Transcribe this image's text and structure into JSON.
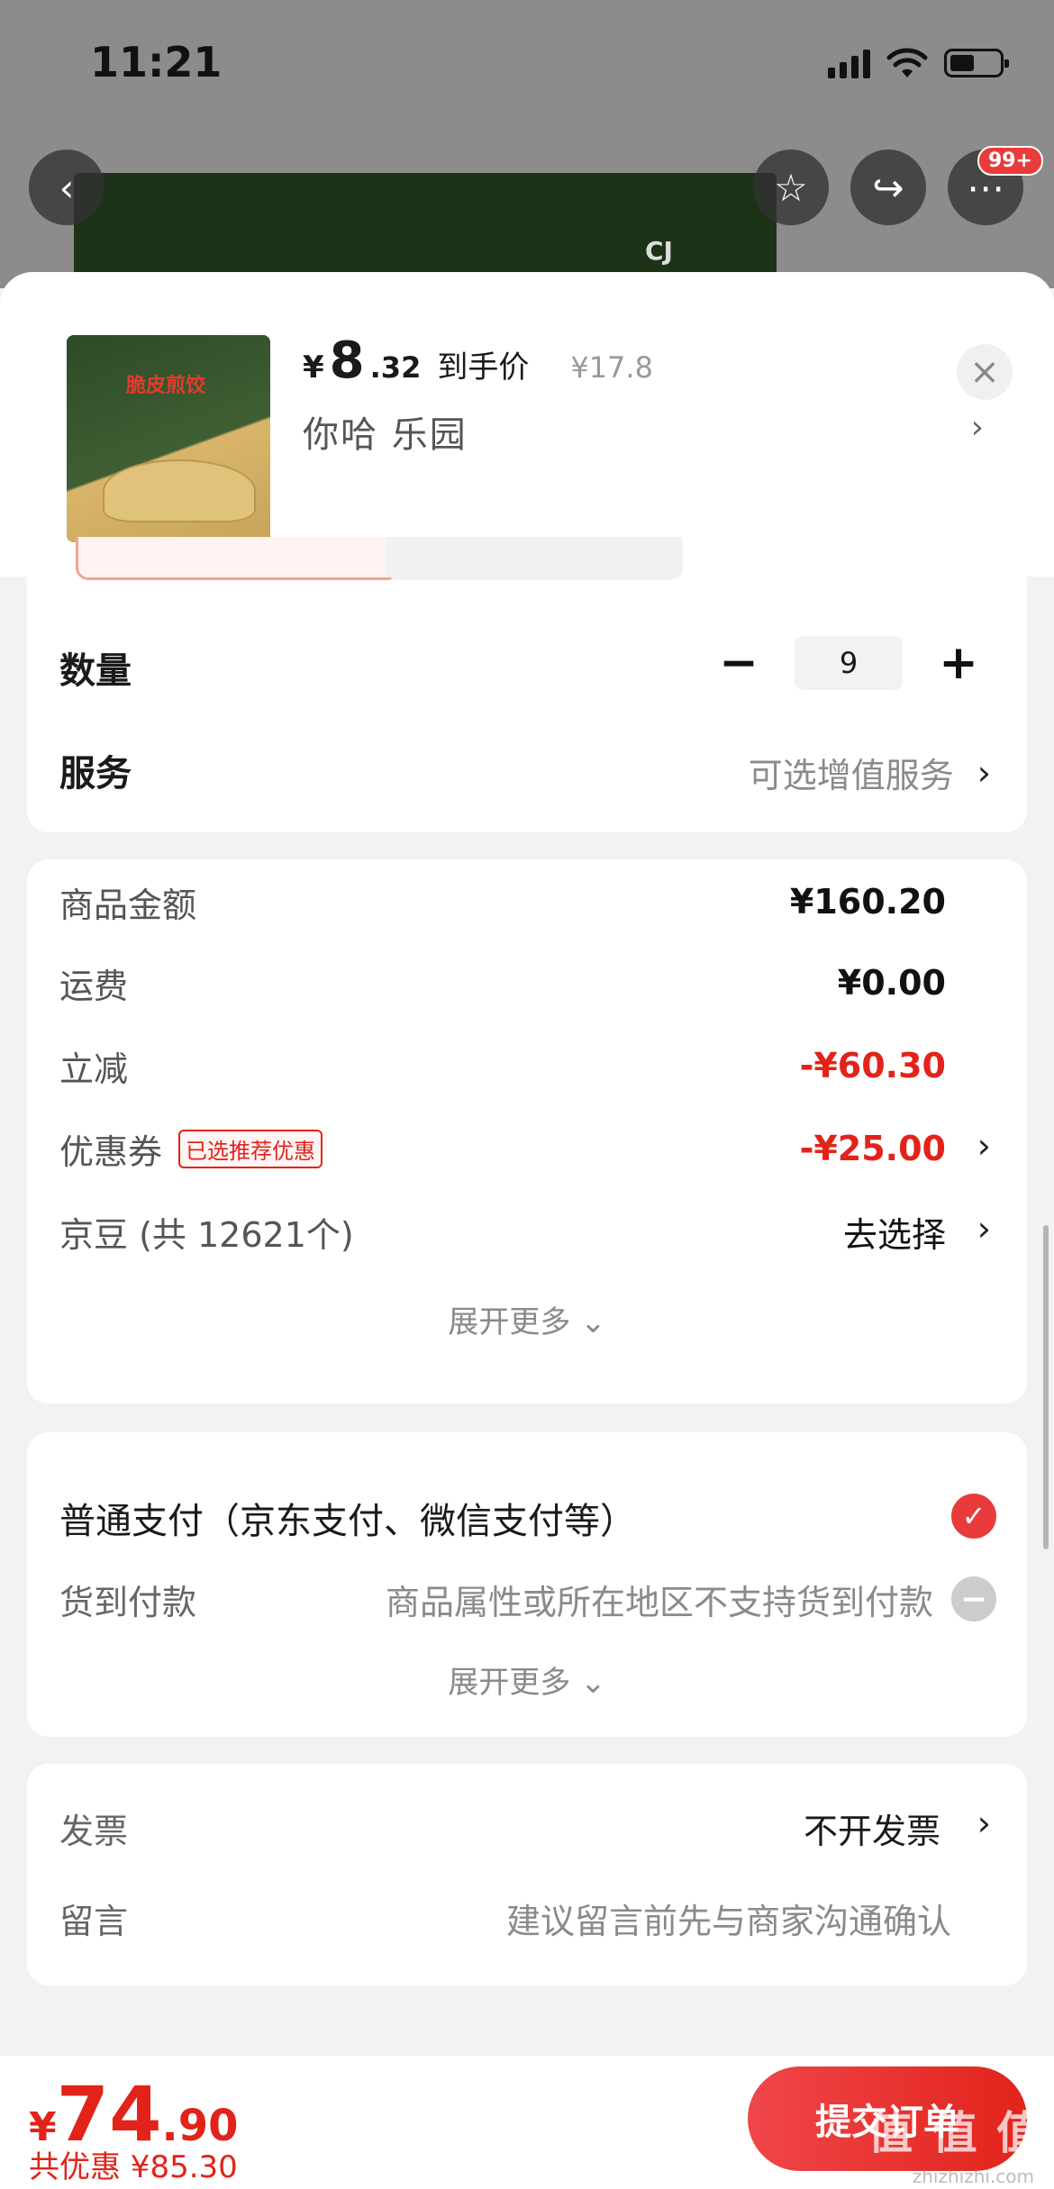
{
  "status": {
    "time": "11:21"
  },
  "header": {
    "badge": "99+"
  },
  "product": {
    "price_symbol": "¥",
    "price_int": "8",
    "price_dec": ".32",
    "price_tag": "到手价",
    "orig_price": "¥17.8",
    "spec": "你哈  乐园",
    "thumb_title": "脆皮煎饺"
  },
  "quantity": {
    "label": "数量",
    "value": "9"
  },
  "service": {
    "label": "服务",
    "value": "可选增值服务"
  },
  "amounts": {
    "goods_label": "商品金额",
    "goods_value": "¥160.20",
    "shipping_label": "运费",
    "shipping_value": "¥0.00",
    "discount_label": "立减",
    "discount_value": "-¥60.30",
    "coupon_label": "优惠券",
    "coupon_tag": "已选推荐优惠",
    "coupon_value": "-¥25.00",
    "beans_label": "京豆 (共 12621个)",
    "beans_value": "去选择",
    "expand": "展开更多 ⌄"
  },
  "payment": {
    "normal": "普通支付（京东支付、微信支付等）",
    "cod_label": "货到付款",
    "cod_msg": "商品属性或所在地区不支持货到付款",
    "expand": "展开更多 ⌄"
  },
  "invoice": {
    "label": "发票",
    "value": "不开发票"
  },
  "note": {
    "label": "留言",
    "placeholder": "建议留言前先与商家沟通确认"
  },
  "bottom": {
    "yen": "¥",
    "total_int": "74",
    "total_dec": ".90",
    "saved": "共优惠 ¥85.30",
    "submit": "提交订单",
    "watermark": "值 值 值",
    "watermark_sub": "zhizhizhi.com"
  },
  "colors": {
    "accent": "#e2231a",
    "background": "#f2f2f2"
  }
}
